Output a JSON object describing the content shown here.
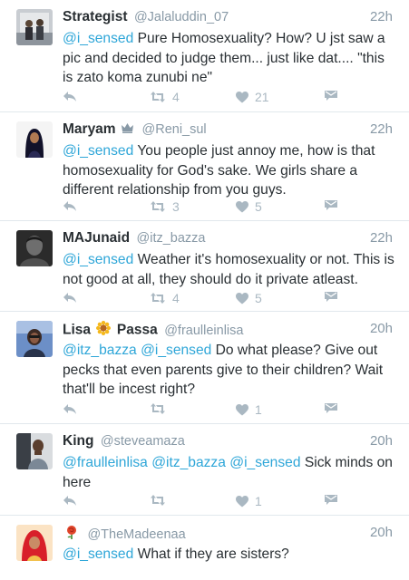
{
  "tweets": [
    {
      "name": "Strategist",
      "handle": "@Jalaluddin_07",
      "time": "22h",
      "text_parts": [
        {
          "text": "@i_sensed",
          "mention": true
        },
        {
          "text": " Pure Homosexuality? How? U jst saw a pic and decided to judge them... just like dat.... \"this is zato koma zunubi ne\"",
          "mention": false
        }
      ],
      "retweets": "4",
      "likes": "21"
    },
    {
      "name": "Maryam",
      "name_badge": "crown-emoji",
      "handle": "@Reni_sul",
      "time": "22h",
      "text_parts": [
        {
          "text": "@i_sensed",
          "mention": true
        },
        {
          "text": " You people just annoy me, how is that homosexuality for God's sake. We girls share a different relationship from you guys.",
          "mention": false
        }
      ],
      "retweets": "3",
      "likes": "5"
    },
    {
      "name": "MAJunaid",
      "handle": "@itz_bazza",
      "time": "22h",
      "text_parts": [
        {
          "text": "@i_sensed",
          "mention": true
        },
        {
          "text": " Weather it's homosexuality or not. This is not good at all, they should do it private atleast.",
          "mention": false
        }
      ],
      "retweets": "4",
      "likes": "5"
    },
    {
      "name": "Lisa",
      "name2": "Passa",
      "name_badge": "sunflower-emoji",
      "handle": "@fraulleinlisa",
      "time": "20h",
      "text_parts": [
        {
          "text": "@itz_bazza",
          "mention": true
        },
        {
          "text": " ",
          "mention": false
        },
        {
          "text": "@i_sensed",
          "mention": true
        },
        {
          "text": " Do what please? Give out pecks that even parents give to their children?  Wait that'll be incest right?",
          "mention": false
        }
      ],
      "retweets": "",
      "likes": "1"
    },
    {
      "name": "King",
      "handle": "@steveamaza",
      "time": "20h",
      "text_parts": [
        {
          "text": "@fraulleinlisa",
          "mention": true
        },
        {
          "text": " ",
          "mention": false
        },
        {
          "text": "@itz_bazza",
          "mention": true
        },
        {
          "text": " ",
          "mention": false
        },
        {
          "text": "@i_sensed",
          "mention": true
        },
        {
          "text": " Sick minds on here",
          "mention": false
        }
      ],
      "retweets": "",
      "likes": "1"
    },
    {
      "name": "",
      "name_badge": "rose-emoji",
      "handle": "@TheMadeenaa",
      "time": "20h",
      "text_parts": [
        {
          "text": "@i_sensed",
          "mention": true
        },
        {
          "text": " What if they are sisters?",
          "mention": false
        }
      ]
    }
  ],
  "colors": {
    "mention": "#2ea6d8",
    "meta": "#8899a6",
    "action": "#aab8c2",
    "divider": "#e1e8ed",
    "text": "#292f33"
  }
}
